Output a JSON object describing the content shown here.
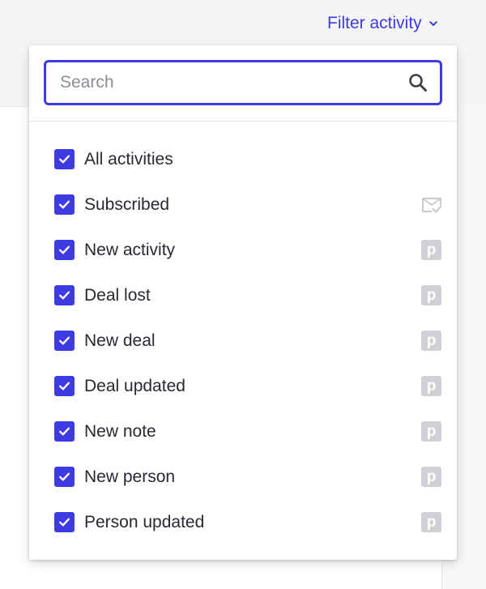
{
  "filter": {
    "label": "Filter activity",
    "chevron_icon": "chevron-down-icon",
    "accent_color": "#3e3be3"
  },
  "search": {
    "placeholder": "Search",
    "value": "",
    "icon": "search-icon"
  },
  "items": [
    {
      "label": "All activities",
      "checked": true,
      "icon": null
    },
    {
      "label": "Subscribed",
      "checked": true,
      "icon": "mail-check-icon"
    },
    {
      "label": "New activity",
      "checked": true,
      "icon": "pipedrive-icon",
      "icon_text": "p"
    },
    {
      "label": "Deal lost",
      "checked": true,
      "icon": "pipedrive-icon",
      "icon_text": "p"
    },
    {
      "label": "New deal",
      "checked": true,
      "icon": "pipedrive-icon",
      "icon_text": "p"
    },
    {
      "label": "Deal updated",
      "checked": true,
      "icon": "pipedrive-icon",
      "icon_text": "p"
    },
    {
      "label": "New note",
      "checked": true,
      "icon": "pipedrive-icon",
      "icon_text": "p"
    },
    {
      "label": "New person",
      "checked": true,
      "icon": "pipedrive-icon",
      "icon_text": "p"
    },
    {
      "label": "Person updated",
      "checked": true,
      "icon": "pipedrive-icon",
      "icon_text": "p"
    }
  ]
}
